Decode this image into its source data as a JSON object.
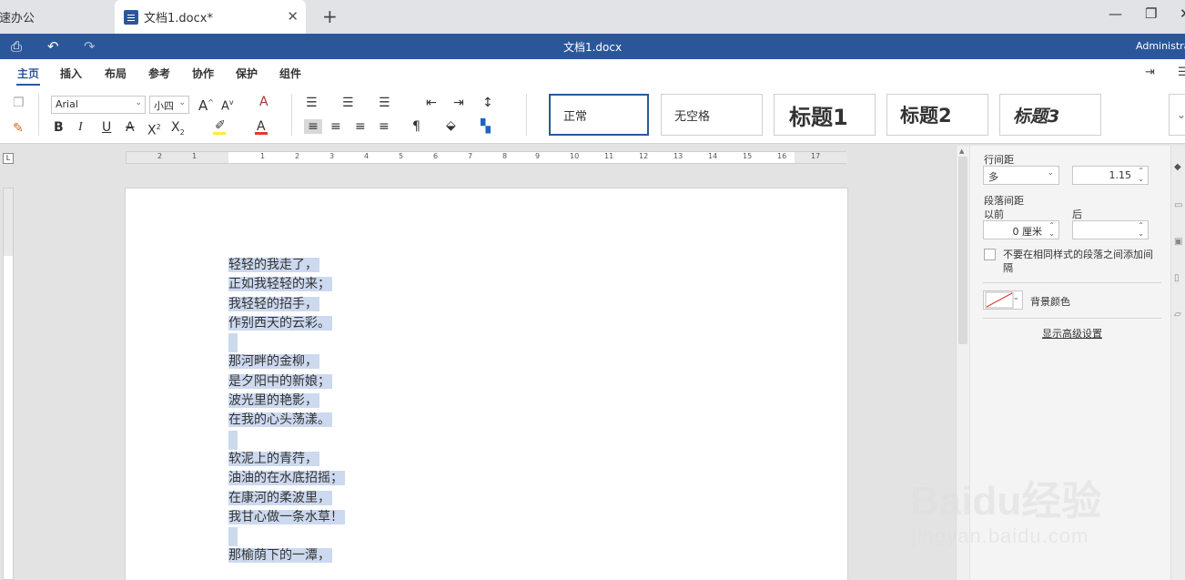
{
  "tabs": [
    {
      "label": "极速办公"
    },
    {
      "label": "文档1.docx*"
    }
  ],
  "titlebar": {
    "title": "文档1.docx",
    "user": "Administrat"
  },
  "menu": {
    "items": [
      "主页",
      "插入",
      "布局",
      "参考",
      "协作",
      "保护",
      "组件"
    ],
    "active": "主页"
  },
  "ribbon": {
    "font_name": "Arial",
    "font_size": "小四",
    "styles": [
      "正常",
      "无空格",
      "标题1",
      "标题2",
      "标题3"
    ],
    "active_style": "正常",
    "highlight_color": "#ffeb3b",
    "font_color": "#e53935"
  },
  "ruler": {
    "h_labels": [
      "2",
      "1",
      "1",
      "2",
      "3",
      "4",
      "5",
      "6",
      "7",
      "8",
      "9",
      "10",
      "11",
      "12",
      "13",
      "14",
      "15",
      "16",
      "17"
    ]
  },
  "document": {
    "lines": [
      "轻轻的我走了，",
      "正如我轻轻的来；",
      "我轻轻的招手，",
      "作别西天的云彩。",
      "",
      "那河畔的金柳，",
      "是夕阳中的新娘；",
      "波光里的艳影，",
      "在我的心头荡漾。",
      "",
      "软泥上的青荇，",
      "油油的在水底招摇；",
      "在康河的柔波里，",
      "我甘心做一条水草！",
      "",
      "那榆荫下的一潭，"
    ],
    "highlight": "#ccd9ef"
  },
  "panel": {
    "line_spacing_label": "行间距",
    "line_spacing_mode": "多",
    "line_spacing_value": "1.15",
    "para_spacing_label": "段落间距",
    "before_label": "以前",
    "after_label": "后",
    "before_value": "0 厘米",
    "after_value": "",
    "checkbox_label": "不要在相同样式的段落之间添加间隔",
    "bg_color_label": "背景颜色",
    "advanced_link": "显示高级设置"
  },
  "watermark": {
    "brand": "Baidu经验",
    "site": "jingyan.baidu.com"
  },
  "colors": {
    "accent": "#2b579a"
  }
}
